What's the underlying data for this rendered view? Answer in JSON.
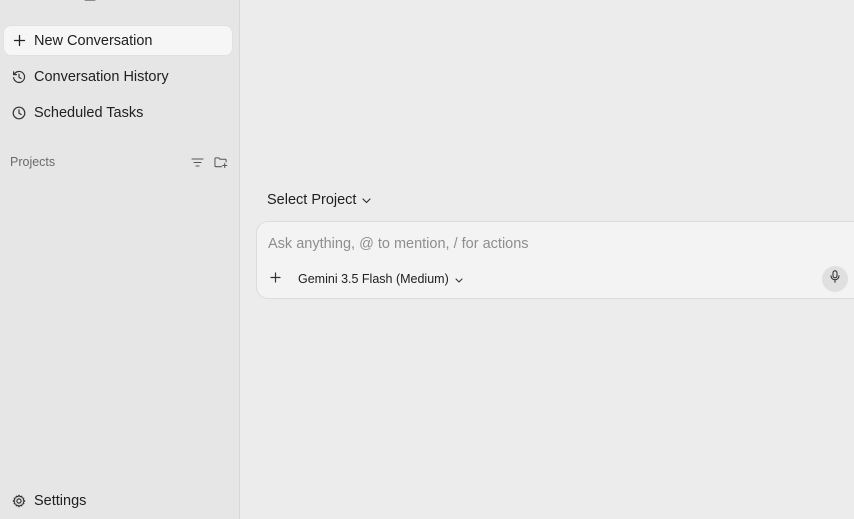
{
  "sidebar": {
    "new_conversation": {
      "label": "New Conversation",
      "icon": "plus-icon"
    },
    "conversation_history": {
      "label": "Conversation History",
      "icon": "history-icon"
    },
    "scheduled_tasks": {
      "label": "Scheduled Tasks",
      "icon": "clock-icon"
    },
    "projects": {
      "label": "Projects",
      "tools": [
        "filter-icon",
        "new-folder-icon"
      ]
    },
    "settings": {
      "label": "Settings",
      "icon": "gear-icon"
    }
  },
  "main": {
    "project_select": {
      "label": "Select Project",
      "icon": "chevron-down-icon"
    },
    "composer": {
      "placeholder": "Ask anything, @ to mention, / for actions",
      "value": "",
      "model_label": "Gemini 3.5 Flash (Medium)",
      "add_icon": "plus-icon",
      "mic_icon": "microphone-icon"
    }
  },
  "colors": {
    "sidebar_bg": "#e6e6e6",
    "main_bg": "#ececec",
    "active_item_bg": "#f6f6f6",
    "placeholder_text": "#8e8e8e",
    "muted_text": "#6b6b6b"
  }
}
